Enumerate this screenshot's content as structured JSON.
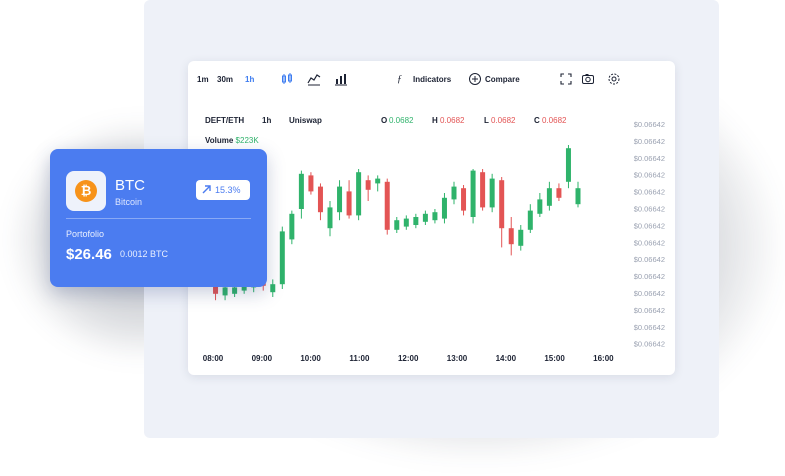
{
  "toolbar": {
    "timeframes": [
      "1m",
      "30m",
      "1h"
    ],
    "active_timeframe": "1h",
    "indicators_label": "Indicators",
    "compare_label": "Compare"
  },
  "market": {
    "pair": "DEFT/ETH",
    "interval": "1h",
    "exchange": "Uniswap",
    "open_label": "O",
    "open_value": "0.0682",
    "high_label": "H",
    "high_value": "0.0682",
    "low_label": "L",
    "low_value": "0.0682",
    "close_label": "C",
    "close_value": "0.0682",
    "volume_label": "Volume",
    "volume_value": "$223K"
  },
  "colors": {
    "up": "#2fb36b",
    "down": "#e35454",
    "accent": "#4b7cf0",
    "coin": "#f7931a"
  },
  "chart_data": {
    "type": "candlestick",
    "x_tick_labels": [
      "08:00",
      "09:00",
      "10:00",
      "11:00",
      "12:00",
      "13:00",
      "14:00",
      "15:00",
      "16:00"
    ],
    "y_tick_labels": [
      "$0.06642",
      "$0.06642",
      "$0.06642",
      "$0.06642",
      "$0.06642",
      "$0.06642",
      "$0.06642",
      "$0.06642",
      "$0.06642",
      "$0.06642",
      "$0.06642",
      "$0.06642",
      "$0.06642",
      "$0.06642"
    ],
    "ylim": [
      0,
      100
    ],
    "candles": [
      {
        "o": 50,
        "c": 53,
        "h": 58,
        "l": 47
      },
      {
        "o": 51,
        "c": 22,
        "h": 53,
        "l": 18
      },
      {
        "o": 21,
        "c": 26,
        "h": 29,
        "l": 18
      },
      {
        "o": 22,
        "c": 26,
        "h": 29,
        "l": 20
      },
      {
        "o": 24,
        "c": 29,
        "h": 31,
        "l": 22
      },
      {
        "o": 26,
        "c": 31,
        "h": 34,
        "l": 23
      },
      {
        "o": 31,
        "c": 27,
        "h": 34,
        "l": 24
      },
      {
        "o": 23,
        "c": 28,
        "h": 31,
        "l": 20
      },
      {
        "o": 28,
        "c": 61,
        "h": 64,
        "l": 25
      },
      {
        "o": 56,
        "c": 72,
        "h": 74,
        "l": 53
      },
      {
        "o": 75,
        "c": 97,
        "h": 99,
        "l": 69
      },
      {
        "o": 96,
        "c": 86,
        "h": 98,
        "l": 84
      },
      {
        "o": 89,
        "c": 73,
        "h": 91,
        "l": 68
      },
      {
        "o": 63,
        "c": 76,
        "h": 80,
        "l": 58
      },
      {
        "o": 73,
        "c": 89,
        "h": 93,
        "l": 68
      },
      {
        "o": 86,
        "c": 71,
        "h": 93,
        "l": 69
      },
      {
        "o": 71,
        "c": 98,
        "h": 100,
        "l": 68
      },
      {
        "o": 93,
        "c": 87,
        "h": 96,
        "l": 80
      },
      {
        "o": 91,
        "c": 94,
        "h": 96,
        "l": 86
      },
      {
        "o": 92,
        "c": 62,
        "h": 94,
        "l": 59
      },
      {
        "o": 62,
        "c": 68,
        "h": 70,
        "l": 60
      },
      {
        "o": 64,
        "c": 69,
        "h": 71,
        "l": 62
      },
      {
        "o": 65,
        "c": 70,
        "h": 72,
        "l": 63
      },
      {
        "o": 67,
        "c": 72,
        "h": 74,
        "l": 65
      },
      {
        "o": 68,
        "c": 73,
        "h": 75,
        "l": 66
      },
      {
        "o": 69,
        "c": 82,
        "h": 85,
        "l": 66
      },
      {
        "o": 81,
        "c": 89,
        "h": 92,
        "l": 78
      },
      {
        "o": 88,
        "c": 74,
        "h": 90,
        "l": 71
      },
      {
        "o": 70,
        "c": 99,
        "h": 100,
        "l": 66
      },
      {
        "o": 98,
        "c": 76,
        "h": 100,
        "l": 74
      },
      {
        "o": 76,
        "c": 94,
        "h": 97,
        "l": 73
      },
      {
        "o": 93,
        "c": 63,
        "h": 95,
        "l": 51
      },
      {
        "o": 63,
        "c": 53,
        "h": 70,
        "l": 46
      },
      {
        "o": 52,
        "c": 62,
        "h": 65,
        "l": 49
      },
      {
        "o": 62,
        "c": 74,
        "h": 78,
        "l": 60
      },
      {
        "o": 72,
        "c": 81,
        "h": 85,
        "l": 70
      },
      {
        "o": 77,
        "c": 88,
        "h": 92,
        "l": 74
      },
      {
        "o": 88,
        "c": 82,
        "h": 91,
        "l": 80
      },
      {
        "o": 92,
        "c": 113,
        "h": 118,
        "l": 88
      },
      {
        "o": 78,
        "c": 88,
        "h": 92,
        "l": 76
      }
    ]
  },
  "btc_card": {
    "coin_glyph": "₿",
    "symbol": "BTC",
    "name": "Bitcoin",
    "change": "15.3%",
    "portfolio_label": "Portofolio",
    "portfolio_value": "$26.46",
    "portfolio_btc": "0.0012 BTC"
  }
}
